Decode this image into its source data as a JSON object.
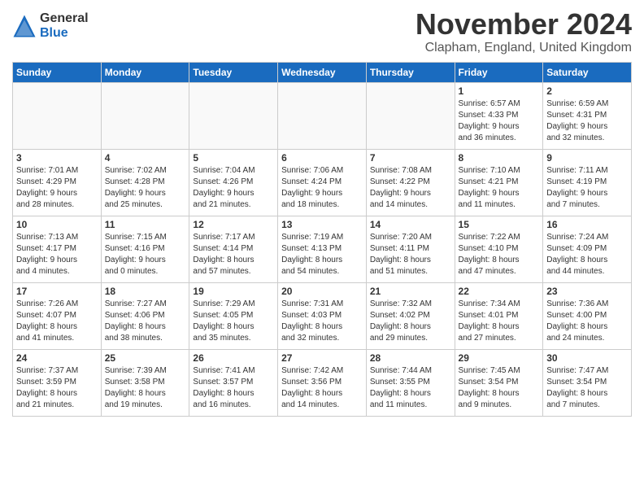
{
  "header": {
    "logo_general": "General",
    "logo_blue": "Blue",
    "month_title": "November 2024",
    "location": "Clapham, England, United Kingdom"
  },
  "days_of_week": [
    "Sunday",
    "Monday",
    "Tuesday",
    "Wednesday",
    "Thursday",
    "Friday",
    "Saturday"
  ],
  "weeks": [
    [
      {
        "day": "",
        "info": "",
        "empty": true
      },
      {
        "day": "",
        "info": "",
        "empty": true
      },
      {
        "day": "",
        "info": "",
        "empty": true
      },
      {
        "day": "",
        "info": "",
        "empty": true
      },
      {
        "day": "",
        "info": "",
        "empty": true
      },
      {
        "day": "1",
        "info": "Sunrise: 6:57 AM\nSunset: 4:33 PM\nDaylight: 9 hours\nand 36 minutes."
      },
      {
        "day": "2",
        "info": "Sunrise: 6:59 AM\nSunset: 4:31 PM\nDaylight: 9 hours\nand 32 minutes."
      }
    ],
    [
      {
        "day": "3",
        "info": "Sunrise: 7:01 AM\nSunset: 4:29 PM\nDaylight: 9 hours\nand 28 minutes."
      },
      {
        "day": "4",
        "info": "Sunrise: 7:02 AM\nSunset: 4:28 PM\nDaylight: 9 hours\nand 25 minutes."
      },
      {
        "day": "5",
        "info": "Sunrise: 7:04 AM\nSunset: 4:26 PM\nDaylight: 9 hours\nand 21 minutes."
      },
      {
        "day": "6",
        "info": "Sunrise: 7:06 AM\nSunset: 4:24 PM\nDaylight: 9 hours\nand 18 minutes."
      },
      {
        "day": "7",
        "info": "Sunrise: 7:08 AM\nSunset: 4:22 PM\nDaylight: 9 hours\nand 14 minutes."
      },
      {
        "day": "8",
        "info": "Sunrise: 7:10 AM\nSunset: 4:21 PM\nDaylight: 9 hours\nand 11 minutes."
      },
      {
        "day": "9",
        "info": "Sunrise: 7:11 AM\nSunset: 4:19 PM\nDaylight: 9 hours\nand 7 minutes."
      }
    ],
    [
      {
        "day": "10",
        "info": "Sunrise: 7:13 AM\nSunset: 4:17 PM\nDaylight: 9 hours\nand 4 minutes."
      },
      {
        "day": "11",
        "info": "Sunrise: 7:15 AM\nSunset: 4:16 PM\nDaylight: 9 hours\nand 0 minutes."
      },
      {
        "day": "12",
        "info": "Sunrise: 7:17 AM\nSunset: 4:14 PM\nDaylight: 8 hours\nand 57 minutes."
      },
      {
        "day": "13",
        "info": "Sunrise: 7:19 AM\nSunset: 4:13 PM\nDaylight: 8 hours\nand 54 minutes."
      },
      {
        "day": "14",
        "info": "Sunrise: 7:20 AM\nSunset: 4:11 PM\nDaylight: 8 hours\nand 51 minutes."
      },
      {
        "day": "15",
        "info": "Sunrise: 7:22 AM\nSunset: 4:10 PM\nDaylight: 8 hours\nand 47 minutes."
      },
      {
        "day": "16",
        "info": "Sunrise: 7:24 AM\nSunset: 4:09 PM\nDaylight: 8 hours\nand 44 minutes."
      }
    ],
    [
      {
        "day": "17",
        "info": "Sunrise: 7:26 AM\nSunset: 4:07 PM\nDaylight: 8 hours\nand 41 minutes."
      },
      {
        "day": "18",
        "info": "Sunrise: 7:27 AM\nSunset: 4:06 PM\nDaylight: 8 hours\nand 38 minutes."
      },
      {
        "day": "19",
        "info": "Sunrise: 7:29 AM\nSunset: 4:05 PM\nDaylight: 8 hours\nand 35 minutes."
      },
      {
        "day": "20",
        "info": "Sunrise: 7:31 AM\nSunset: 4:03 PM\nDaylight: 8 hours\nand 32 minutes."
      },
      {
        "day": "21",
        "info": "Sunrise: 7:32 AM\nSunset: 4:02 PM\nDaylight: 8 hours\nand 29 minutes."
      },
      {
        "day": "22",
        "info": "Sunrise: 7:34 AM\nSunset: 4:01 PM\nDaylight: 8 hours\nand 27 minutes."
      },
      {
        "day": "23",
        "info": "Sunrise: 7:36 AM\nSunset: 4:00 PM\nDaylight: 8 hours\nand 24 minutes."
      }
    ],
    [
      {
        "day": "24",
        "info": "Sunrise: 7:37 AM\nSunset: 3:59 PM\nDaylight: 8 hours\nand 21 minutes."
      },
      {
        "day": "25",
        "info": "Sunrise: 7:39 AM\nSunset: 3:58 PM\nDaylight: 8 hours\nand 19 minutes."
      },
      {
        "day": "26",
        "info": "Sunrise: 7:41 AM\nSunset: 3:57 PM\nDaylight: 8 hours\nand 16 minutes."
      },
      {
        "day": "27",
        "info": "Sunrise: 7:42 AM\nSunset: 3:56 PM\nDaylight: 8 hours\nand 14 minutes."
      },
      {
        "day": "28",
        "info": "Sunrise: 7:44 AM\nSunset: 3:55 PM\nDaylight: 8 hours\nand 11 minutes."
      },
      {
        "day": "29",
        "info": "Sunrise: 7:45 AM\nSunset: 3:54 PM\nDaylight: 8 hours\nand 9 minutes."
      },
      {
        "day": "30",
        "info": "Sunrise: 7:47 AM\nSunset: 3:54 PM\nDaylight: 8 hours\nand 7 minutes."
      }
    ]
  ]
}
